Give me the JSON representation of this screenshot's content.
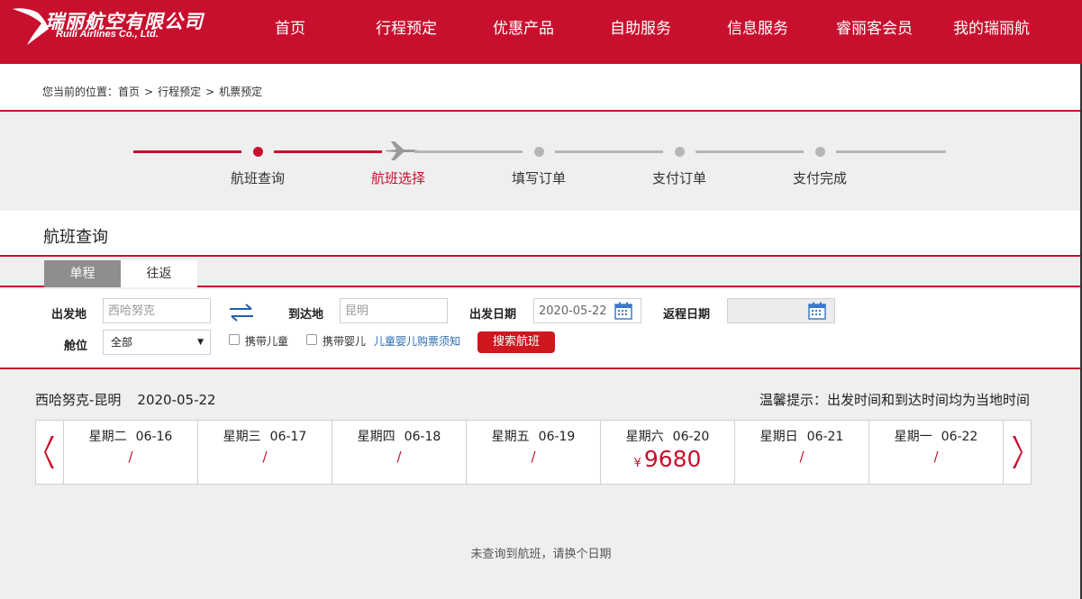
{
  "header": {
    "logo_cn": "瑞丽航空有限公司",
    "logo_en": "Ruili Airlines Co., Ltd.",
    "nav": [
      "首页",
      "行程预定",
      "优惠产品",
      "自助服务",
      "信息服务",
      "睿丽客会员",
      "我的瑞丽航"
    ]
  },
  "breadcrumb": {
    "prefix": "您当前的位置：",
    "items": [
      "首页",
      "行程预定",
      "机票预定"
    ],
    "sep": ">"
  },
  "steps": {
    "labels": [
      "航班查询",
      "航班选择",
      "填写订单",
      "支付订单",
      "支付完成"
    ],
    "active_index": 1
  },
  "section": {
    "title": "航班查询"
  },
  "trip_tabs": {
    "one_way": "单程",
    "round_trip": "往返"
  },
  "form": {
    "from_label": "出发地",
    "from_placeholder": "西哈努克",
    "to_label": "到达地",
    "to_placeholder": "昆明",
    "depart_label": "出发日期",
    "depart_value": "2020-05-22",
    "return_label": "返程日期",
    "cabin_label": "舱位",
    "cabin_value": "全部",
    "child_label": "携带儿童",
    "infant_label": "携带婴儿",
    "notice_link": "儿童婴儿购票须知",
    "search_button": "搜索航班"
  },
  "results": {
    "route": "西哈努克-昆明",
    "date": "2020-05-22",
    "tip": "温馨提示：出发时间和到达时间均为当地时间",
    "dates": [
      {
        "weekday": "星期二",
        "date": "06-16",
        "price": "/"
      },
      {
        "weekday": "星期三",
        "date": "06-17",
        "price": "/"
      },
      {
        "weekday": "星期四",
        "date": "06-18",
        "price": "/"
      },
      {
        "weekday": "星期五",
        "date": "06-19",
        "price": "/"
      },
      {
        "weekday": "星期六",
        "date": "06-20",
        "currency": "¥",
        "price": "9680"
      },
      {
        "weekday": "星期日",
        "date": "06-21",
        "price": "/"
      },
      {
        "weekday": "星期一",
        "date": "06-22",
        "price": "/"
      }
    ],
    "empty_message": "未查询到航班，请换个日期"
  },
  "colors": {
    "brand": "#c8102e",
    "inactive": "#b5b5b5"
  },
  "icons": [
    "ruili-logo-icon",
    "plane-icon",
    "swap-arrows-icon",
    "calendar-icon",
    "chevron-left-icon",
    "chevron-right-icon",
    "dropdown-arrow-icon"
  ]
}
